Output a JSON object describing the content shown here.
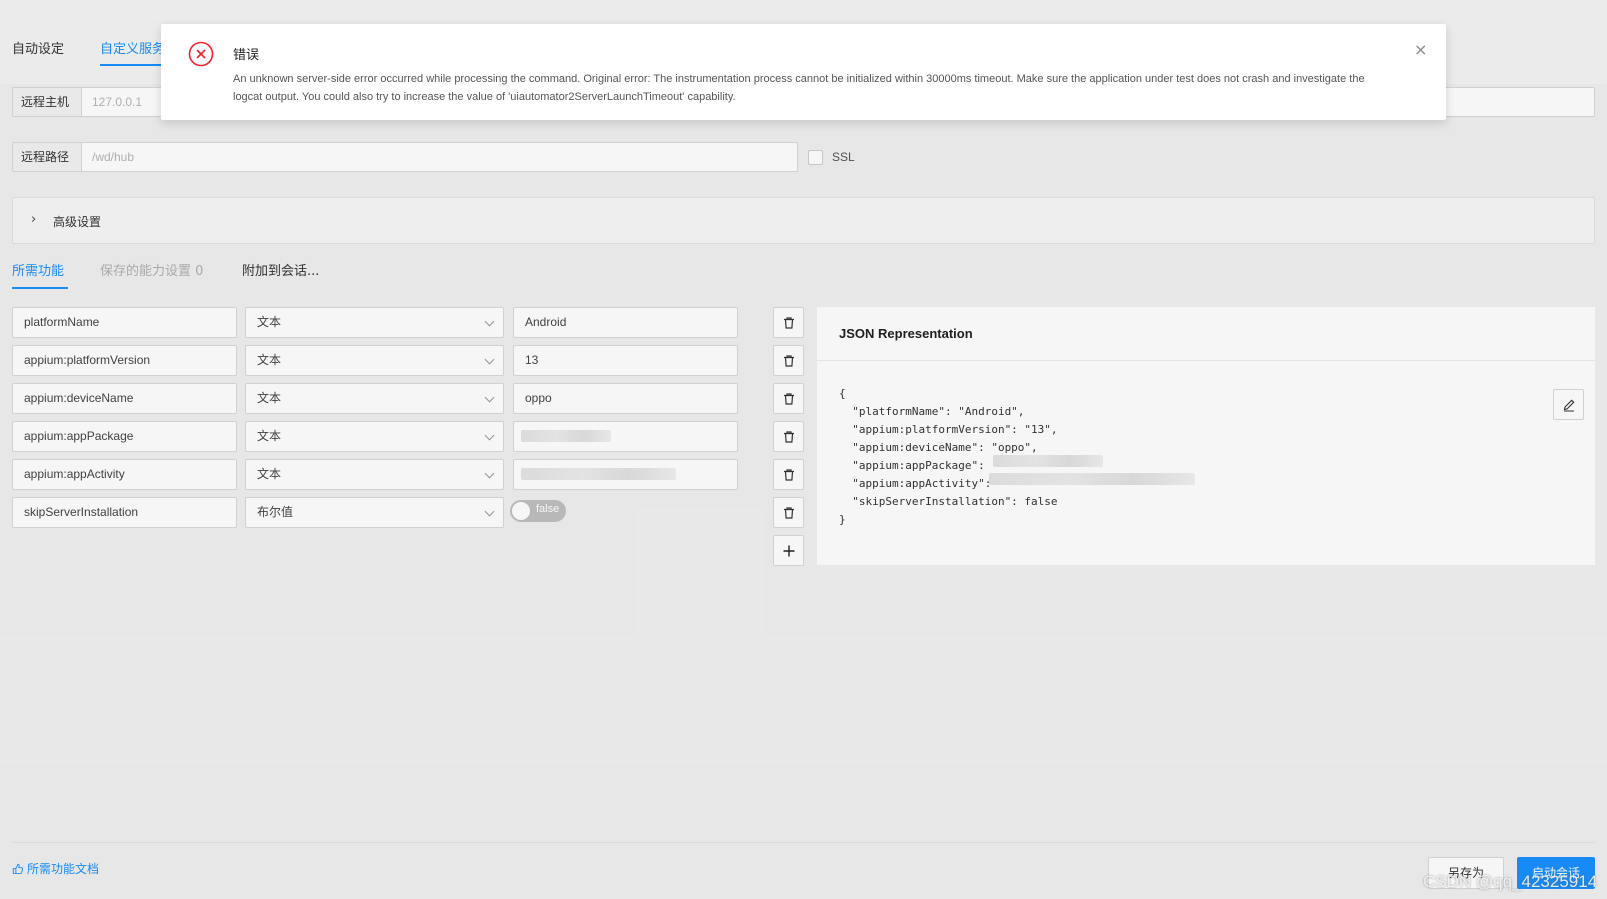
{
  "server_tabs": [
    {
      "label": "自动设定",
      "active": false
    },
    {
      "label": "自定义服务",
      "active": true
    }
  ],
  "remote_host": {
    "label": "远程主机",
    "placeholder": "127.0.0.1"
  },
  "remote_path": {
    "label": "远程路径",
    "placeholder": "/wd/hub"
  },
  "ssl": {
    "label": "SSL",
    "checked": false
  },
  "advanced": {
    "label": "高级设置"
  },
  "capability_tabs": [
    {
      "label": "所需功能",
      "state": "active"
    },
    {
      "label": "保存的能力设置 0",
      "state": "disabled"
    },
    {
      "label": "附加到会话...",
      "state": "normal"
    }
  ],
  "capabilities": [
    {
      "name": "platformName",
      "type": "文本",
      "value": "Android"
    },
    {
      "name": "appium:platformVersion",
      "type": "文本",
      "value": "13"
    },
    {
      "name": "appium:deviceName",
      "type": "文本",
      "value": "oppo"
    },
    {
      "name": "appium:appPackage",
      "type": "文本",
      "value": ""
    },
    {
      "name": "appium:appActivity",
      "type": "文本",
      "value": ""
    },
    {
      "name": "skipServerInstallation",
      "type": "布尔值",
      "value": "false"
    }
  ],
  "json_panel": {
    "title": "JSON Representation",
    "lines": [
      "{",
      "  \"platformName\": \"Android\",",
      "  \"appium:platformVersion\": \"13\",",
      "  \"appium:deviceName\": \"oppo\",",
      "  \"appium:appPackage\":",
      "  \"appium:appActivity\":",
      "  \"skipServerInstallation\": false",
      "}"
    ]
  },
  "footer": {
    "docs_link": "所需功能文档",
    "save_as_label": "另存为",
    "start_session_label": "启动会话",
    "watermark": "CSDN @qq_42325914"
  },
  "notification": {
    "title": "错误",
    "message": "An unknown server-side error occurred while processing the command. Original error: The instrumentation process cannot be initialized within 30000ms timeout. Make sure the application under test does not crash and investigate the logcat output. You could also try to increase the value of 'uiautomator2ServerLaunchTimeout' capability.",
    "close_glyph": "×"
  },
  "colors": {
    "accent": "#1890ff",
    "error": "#f5222d",
    "toggle_off": "#bfbfbf"
  }
}
